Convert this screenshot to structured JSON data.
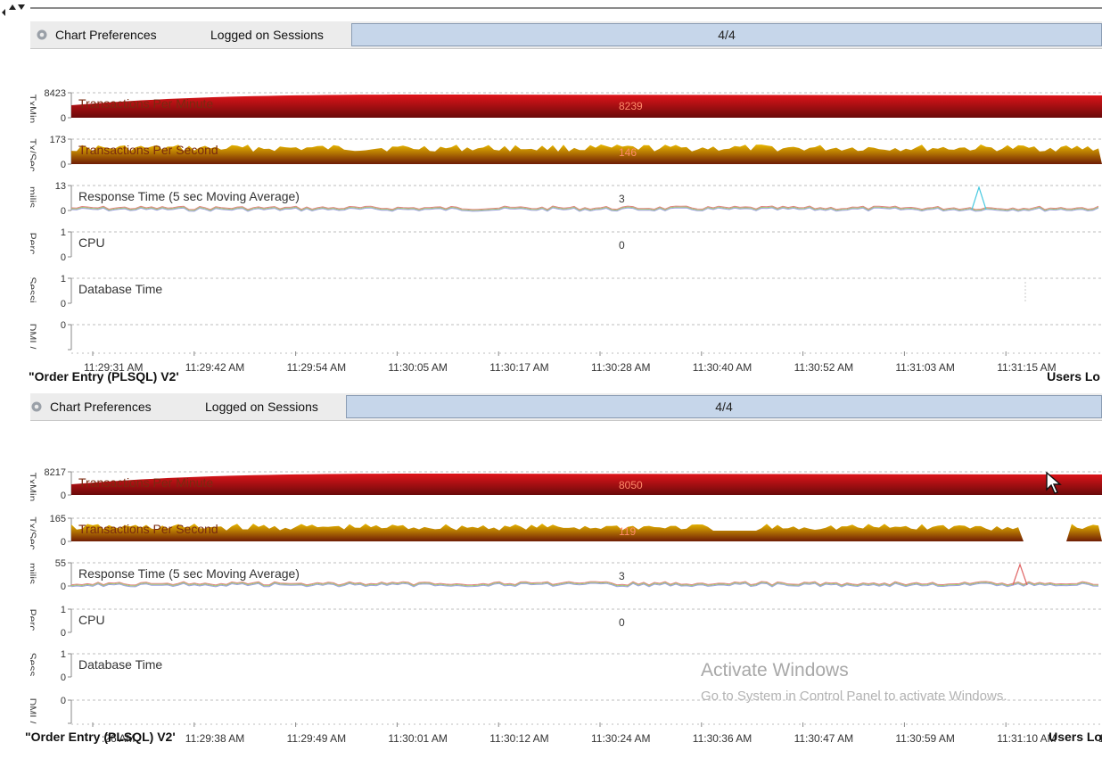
{
  "panels": [
    {
      "toolbar": {
        "prefs_label": "Chart Preferences",
        "sessions_label": "Logged on Sessions",
        "sessions_value": "4/4",
        "sessions_fraction": 1.0
      },
      "axis_labels": [
        "TxMin",
        "Tx/Sec",
        "milis...",
        "Perc...",
        "Sessi...",
        "DML/..."
      ],
      "rows": [
        {
          "title": "Transactions Per Minute",
          "value": "8239",
          "ymax": "8423",
          "ymin": "0"
        },
        {
          "title": "Transactions Per Second",
          "value": "146",
          "ymax": "173",
          "ymin": "0"
        },
        {
          "title": "Response Time (5 sec Moving Average)",
          "value": "3",
          "ymax": "13",
          "ymin": "0"
        },
        {
          "title": "CPU",
          "value": "0",
          "ymax": "1",
          "ymin": "0"
        },
        {
          "title": "Database Time",
          "value": "",
          "ymax": "1",
          "ymin": "0"
        },
        {
          "title": "",
          "value": "",
          "ymax": "0",
          "ymin": ""
        }
      ],
      "time_ticks": [
        "11:29:31 AM",
        "11:29:42 AM",
        "11:29:54 AM",
        "11:30:05 AM",
        "11:30:17 AM",
        "11:30:28 AM",
        "11:30:40 AM",
        "11:30:52 AM",
        "11:31:03 AM",
        "11:31:15 AM"
      ],
      "footer_left": "\"Order Entry (PLSQL) V2'",
      "footer_right": "Users Lo"
    },
    {
      "toolbar": {
        "prefs_label": "Chart Preferences",
        "sessions_label": "Logged on Sessions",
        "sessions_value": "4/4",
        "sessions_fraction": 1.0
      },
      "axis_labels": [
        "TxMin",
        "Tx/Sec",
        "milis...",
        "Perc...",
        "Sess...",
        "DML/..."
      ],
      "rows": [
        {
          "title": "Transactions Per Minute",
          "value": "8050",
          "ymax": "8217",
          "ymin": "0"
        },
        {
          "title": "Transactions Per Second",
          "value": "119",
          "ymax": "165",
          "ymin": "0"
        },
        {
          "title": "Response Time (5 sec Moving Average)",
          "value": "3",
          "ymax": "55",
          "ymin": "0"
        },
        {
          "title": "CPU",
          "value": "0",
          "ymax": "1",
          "ymin": "0"
        },
        {
          "title": "Database Time",
          "value": "",
          "ymax": "1",
          "ymin": "0"
        },
        {
          "title": "",
          "value": "",
          "ymax": "0",
          "ymin": ""
        }
      ],
      "time_ticks": [
        ":26 AM",
        "11:29:38 AM",
        "11:29:49 AM",
        "11:30:01 AM",
        "11:30:12 AM",
        "11:30:24 AM",
        "11:30:36 AM",
        "11:30:47 AM",
        "11:30:59 AM",
        "11:31:10 AM",
        "11:31:"
      ],
      "footer_left": "\"Order Entry (PLSQL) V2'",
      "footer_right": "Users Lo"
    }
  ],
  "watermark": {
    "title": "Activate Windows",
    "subtitle": "Go to System in Control Panel to activate Windows."
  },
  "colors": {
    "tpm_top": "#e0141a",
    "tpm_bottom": "#6a0a0a",
    "tps_top": "#e8b800",
    "tps_bottom": "#6e1c05",
    "grid": "#bdbdbd",
    "progress": "#c6d6ea"
  }
}
